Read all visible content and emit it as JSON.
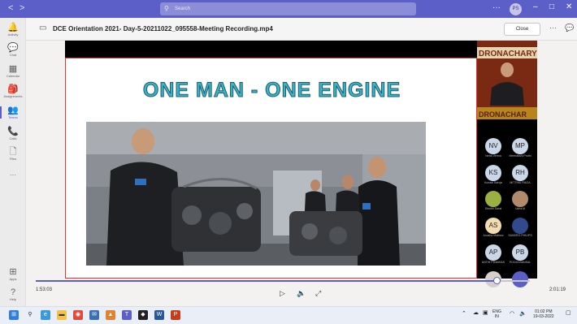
{
  "titlebar": {
    "search_placeholder": "Search",
    "more": "···",
    "user_initials": "PS",
    "nav_back": "<",
    "nav_forward": ">",
    "minimize": "–",
    "maximize": "□",
    "close": "✕"
  },
  "rail": {
    "items": [
      {
        "label": "Activity",
        "icon": "bell-icon",
        "glyph": "🔔"
      },
      {
        "label": "Chat",
        "icon": "chat-icon",
        "glyph": "💬"
      },
      {
        "label": "Calendar",
        "icon": "calendar-icon",
        "glyph": "▦"
      },
      {
        "label": "Assignments",
        "icon": "assignments-icon",
        "glyph": "🎒"
      },
      {
        "label": "Teams",
        "icon": "teams-icon",
        "glyph": "👥"
      },
      {
        "label": "Calls",
        "icon": "phone-icon",
        "glyph": "📞"
      },
      {
        "label": "Files",
        "icon": "file-icon",
        "glyph": "🗋"
      },
      {
        "label": "···",
        "icon": "more-icon",
        "glyph": ""
      }
    ],
    "bottom": [
      {
        "label": "Apps",
        "icon": "apps-icon",
        "glyph": "⊞"
      },
      {
        "label": "Help",
        "icon": "help-icon",
        "glyph": "?"
      }
    ],
    "active_label": "Teams"
  },
  "file": {
    "title": "DCE Orientation 2021- Day-5-20211022_095558-Meeting Recording.mp4",
    "close_label": "Close"
  },
  "slide": {
    "title": "ONE MAN - ONE ENGINE"
  },
  "participants": [
    {
      "initials": "NV",
      "name": "Neha Verma",
      "color": "#bcd0ea"
    },
    {
      "initials": "MP",
      "name": "Meenakshi Pruthi",
      "color": "#bcd0ea"
    },
    {
      "initials": "KS",
      "name": "Kunaal Saroja",
      "color": "#bcd0ea"
    },
    {
      "initials": "RH",
      "name": "MITTHAI RAIZA",
      "color": "#bcd0ea"
    },
    {
      "initials": "",
      "name": "Shruthi Sarat",
      "color": "#9ab042"
    },
    {
      "initials": "",
      "name": "Usha M",
      "color": "#b08a6a"
    },
    {
      "initials": "AS",
      "name": "Anusha Mathew",
      "color": "#f2ddb0"
    },
    {
      "initials": "",
      "name": "SANDRO PHILIPS",
      "color": "#314a8c"
    },
    {
      "initials": "AP",
      "name": "ANTHI PRABHAS",
      "color": "#bcd0ea"
    },
    {
      "initials": "PB",
      "name": "POOJA BANSAL",
      "color": "#bcd0ea"
    },
    {
      "initials": "",
      "name": "Smiti Aurora",
      "color": "#d8d0c8"
    },
    {
      "initials": "",
      "name": "",
      "color": "#5b5fc7"
    }
  ],
  "player": {
    "current_time": "1:53:03",
    "total_time": "2:01:19",
    "progress": 0.932,
    "play_icon": "▷",
    "volume_icon": "🔈",
    "fullscreen_icon": "⤢"
  },
  "taskbar": {
    "lang_top": "ENG",
    "lang_bottom": "IN",
    "time": "01:02 PM",
    "date": "19-03-2022"
  },
  "colors": {
    "accent": "#5b5fc7",
    "slide_title": "#3bb3c8"
  }
}
